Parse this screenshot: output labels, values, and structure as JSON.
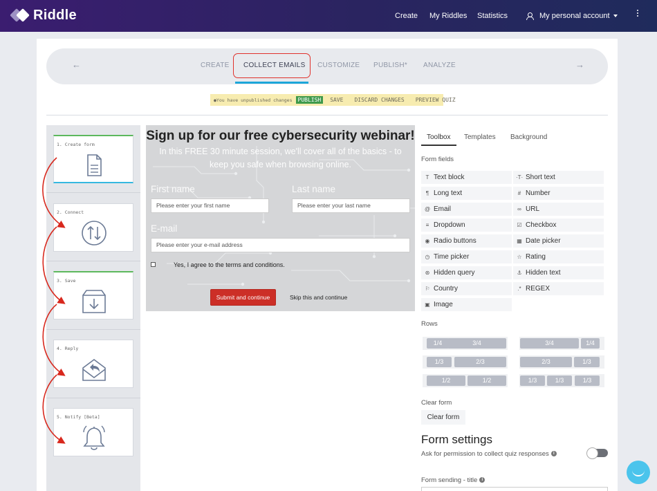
{
  "topbar": {
    "brand": "Riddle",
    "nav": [
      "Create",
      "My Riddles",
      "Statistics"
    ],
    "account": "My personal account"
  },
  "steps": {
    "back": "←",
    "forward": "→",
    "tabs": [
      "CREATE",
      "COLLECT EMAILS",
      "CUSTOMIZE",
      "PUBLISH*",
      "ANALYZE"
    ],
    "active": "COLLECT EMAILS"
  },
  "changes": {
    "note": "●You have unpublished changes",
    "publish": "PUBLISH",
    "save": "SAVE",
    "discard": "DISCARD CHANGES",
    "preview": "PREVIEW QUIZ"
  },
  "sidebar": {
    "steps": [
      "1. Create form",
      "2. Connect",
      "3. Save",
      "4. Reply",
      "5. Notify [Beta]"
    ]
  },
  "form_preview": {
    "title": "Sign up for our free cybersecurity webinar!",
    "subtitle": "In this FREE 30 minute session, we'll cover all of the basics - to keep you safe when browsing online.",
    "first_name_label": "First name",
    "first_name_placeholder": "Please enter your first name",
    "last_name_label": "Last name",
    "last_name_placeholder": "Please enter your last name",
    "email_label": "E-mail",
    "email_placeholder": "Please enter your e-mail address",
    "terms": "Yes, I agree to the terms and conditions.",
    "submit": "Submit and continue",
    "skip": "Skip this and continue"
  },
  "toolbox": {
    "tabs": [
      "Toolbox",
      "Templates",
      "Background"
    ],
    "form_fields_label": "Form fields",
    "fields": [
      {
        "icon": "T",
        "label": "Text block"
      },
      {
        "icon": "·T·",
        "label": "Short text"
      },
      {
        "icon": "¶",
        "label": "Long text"
      },
      {
        "icon": "#",
        "label": "Number"
      },
      {
        "icon": "@",
        "label": "Email"
      },
      {
        "icon": "∞",
        "label": "URL"
      },
      {
        "icon": "≡",
        "label": "Dropdown"
      },
      {
        "icon": "☑",
        "label": "Checkbox"
      },
      {
        "icon": "◉",
        "label": "Radio buttons"
      },
      {
        "icon": "▦",
        "label": "Date picker"
      },
      {
        "icon": "◷",
        "label": "Time picker"
      },
      {
        "icon": "☆",
        "label": "Rating"
      },
      {
        "icon": "⊛",
        "label": "Hidden query"
      },
      {
        "icon": "⚓",
        "label": "Hidden text"
      },
      {
        "icon": "⚐",
        "label": "Country"
      },
      {
        "icon": ".*",
        "label": "REGEX"
      },
      {
        "icon": "▣",
        "label": "Image"
      }
    ],
    "rows_label": "Rows",
    "rows": [
      [
        "1/4",
        "3/4"
      ],
      [
        "3/4",
        "1/4"
      ],
      [
        "1/3",
        "2/3"
      ],
      [
        "2/3",
        "1/3"
      ],
      [
        "1/2",
        "1/2"
      ],
      [
        "1/3",
        "1/3",
        "1/3"
      ]
    ],
    "clear_form_label": "Clear form",
    "clear_form_button": "Clear form",
    "form_settings_title": "Form settings",
    "permission_label": "Ask for permission to collect quiz responses",
    "sending_title_label": "Form sending - title"
  }
}
